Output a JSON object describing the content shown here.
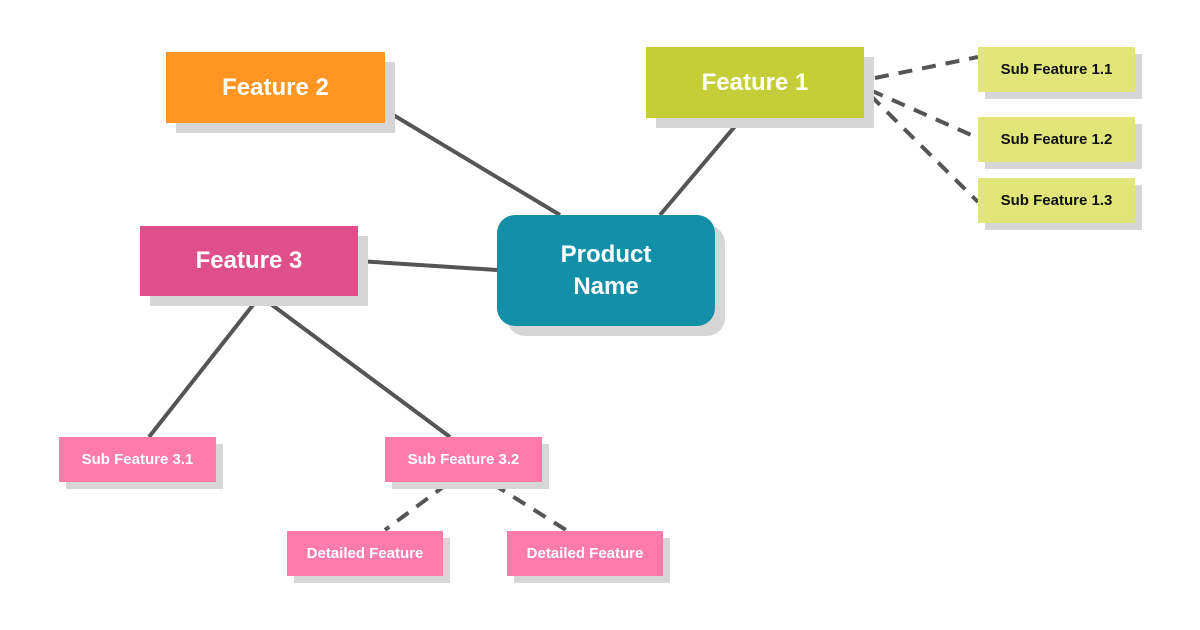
{
  "colors": {
    "feature1": "#C5CE38",
    "feature2": "#FF9522",
    "feature3": "#DF4F8A",
    "sub1": "#E2E67A",
    "sub3": "#FF7BAC",
    "product": "#148FA8",
    "connector": "#555555",
    "shadow": "#D6D6D6"
  },
  "product": {
    "label": "Product Name"
  },
  "features": [
    {
      "label": "Feature 1"
    },
    {
      "label": "Feature 2"
    },
    {
      "label": "Feature 3"
    }
  ],
  "sub_features_1": [
    {
      "label": "Sub Feature 1.1"
    },
    {
      "label": "Sub Feature 1.2"
    },
    {
      "label": "Sub Feature 1.3"
    }
  ],
  "sub_features_3": [
    {
      "label": "Sub Feature 3.1"
    },
    {
      "label": "Sub Feature 3.2"
    }
  ],
  "detailed_features": [
    {
      "label": "Detailed Feature"
    },
    {
      "label": "Detailed Feature"
    }
  ]
}
